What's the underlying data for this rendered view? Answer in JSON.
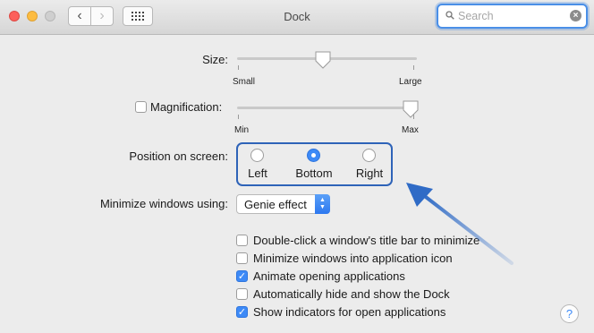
{
  "window": {
    "title": "Dock"
  },
  "toolbar": {
    "back_glyph": "‹",
    "forward_glyph": "›"
  },
  "search": {
    "placeholder": "Search",
    "value": ""
  },
  "size": {
    "label": "Size:",
    "min_label": "Small",
    "max_label": "Large",
    "value_fraction": 0.47
  },
  "magnification": {
    "label": "Magnification:",
    "checked": false,
    "min_label": "Min",
    "max_label": "Max",
    "value_fraction": 1.0
  },
  "position": {
    "label": "Position on screen:",
    "options": [
      {
        "label": "Left",
        "selected": false
      },
      {
        "label": "Bottom",
        "selected": true
      },
      {
        "label": "Right",
        "selected": false
      }
    ]
  },
  "minimize": {
    "label": "Minimize windows using:",
    "selected": "Genie effect"
  },
  "checkboxes": [
    {
      "label": "Double-click a window's title bar to minimize",
      "checked": false
    },
    {
      "label": "Minimize windows into application icon",
      "checked": false
    },
    {
      "label": "Animate opening applications",
      "checked": true
    },
    {
      "label": "Automatically hide and show the Dock",
      "checked": false
    },
    {
      "label": "Show indicators for open applications",
      "checked": true
    }
  ],
  "help": {
    "glyph": "?"
  },
  "colors": {
    "accent": "#3d8af7",
    "highlight_border": "#2e63b8",
    "arrow": "#2f6bc6"
  }
}
